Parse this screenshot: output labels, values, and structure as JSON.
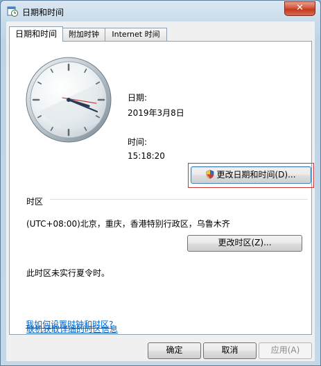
{
  "window": {
    "title": "日期和时间",
    "close_glyph": "✕"
  },
  "tabs": [
    {
      "label": "日期和时间",
      "active": true
    },
    {
      "label": "附加时钟",
      "active": false
    },
    {
      "label": "Internet 时间",
      "active": false
    }
  ],
  "datetime": {
    "date_label": "日期:",
    "date_value": "2019年3月8日",
    "time_label": "时间:",
    "time_value": "15:18:20",
    "change_button": "更改日期和时间(D)..."
  },
  "timezone": {
    "section_label": "时区",
    "value": "(UTC+08:00)北京，重庆，香港特别行政区，乌鲁木齐",
    "change_button": "更改时区(Z)...",
    "dst_note": "此时区未实行夏令时。"
  },
  "links": {
    "online_info": "联机获取详细的时区信息",
    "how_to": "我如何设置时钟和时区?"
  },
  "footer": {
    "ok": "确定",
    "cancel": "取消",
    "apply": "应用(A)"
  },
  "icons": {
    "app": "clock-calendar-icon",
    "shield": "uac-shield-icon"
  }
}
